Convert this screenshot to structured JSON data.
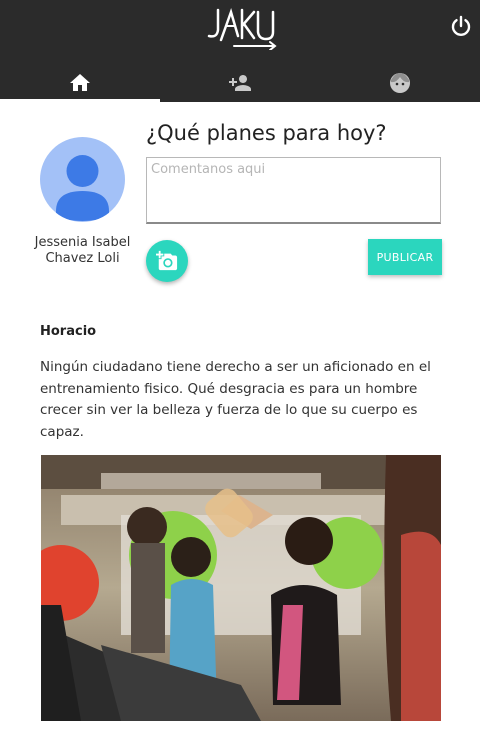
{
  "header": {
    "logo_text": "JAKU",
    "logo_icon": "jaku-logo",
    "power_icon": "power-icon",
    "background": "#2b2b2b"
  },
  "tabs": [
    {
      "icon": "home-icon",
      "active": true
    },
    {
      "icon": "add-person-icon",
      "active": false
    },
    {
      "icon": "face-icon",
      "active": false
    }
  ],
  "profile": {
    "name": "Jessenia Isabel Chavez Loli",
    "avatar_icon": "person-avatar-icon",
    "avatar_color": "#a3c1f7"
  },
  "composer": {
    "prompt": "¿Qué planes para hoy?",
    "placeholder": "Comentanos aqui",
    "value": "",
    "camera_icon": "add-photo-icon",
    "publish_label": "PUBLICAR",
    "accent_color": "#2bd6be"
  },
  "post": {
    "author": "Horacio",
    "text": "Ningún ciudadano tiene derecho a ser un aficionado en el entrenamiento fisico. Qué desgracia es para un hombre crecer sin ver la belleza y fuerza de lo que su cuerpo es capaz.",
    "image": "gym-treadmill-photo"
  }
}
